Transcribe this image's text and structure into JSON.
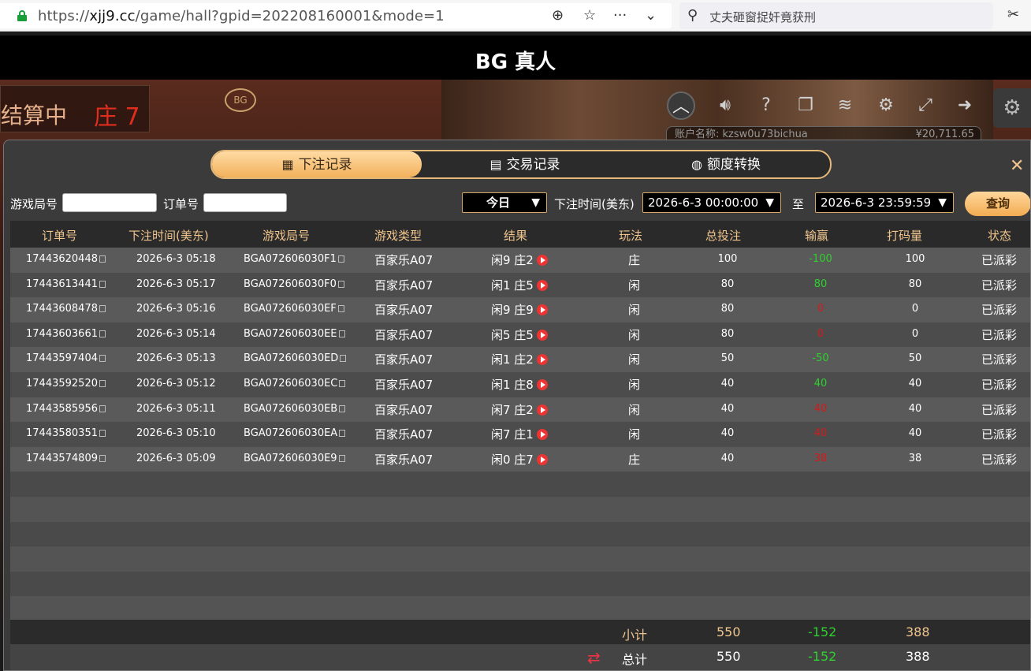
{
  "browser": {
    "url_prefix": "https://",
    "url_host": "xjj9.cc",
    "url_path": "/game/hall?gpid=202208160001&mode=1",
    "search_placeholder": "丈夫砸窗捉奸竟获刑"
  },
  "app": {
    "title": "BG 真人"
  },
  "game": {
    "settle_status": "结算中",
    "settle_result": "庄 7",
    "account_label": "账户名称: kzsw0u73bichua",
    "balance": "¥20,711.65"
  },
  "tabs": [
    {
      "label": "下注记录",
      "icon": "calendar-icon",
      "active": true
    },
    {
      "label": "交易记录",
      "icon": "clipboard-icon",
      "active": false
    },
    {
      "label": "额度转换",
      "icon": "coins-icon",
      "active": false
    }
  ],
  "filters": {
    "round_label": "游戏局号",
    "order_label": "订单号",
    "period_value": "今日",
    "time_label": "下注时间(美东)",
    "start_time": "2026-6-3 00:00:00",
    "to_label": "至",
    "end_time": "2026-6-3 23:59:59",
    "query_label": "查询"
  },
  "table": {
    "columns": [
      "订单号",
      "下注时间(美东)",
      "游戏局号",
      "游戏类型",
      "结果",
      "玩法",
      "总投注",
      "输赢",
      "打码量",
      "状态"
    ],
    "rows": [
      {
        "order": "17443620448",
        "time": "2026-6-3 05:18",
        "round": "BGA072606030F1",
        "type": "百家乐A07",
        "result": "闲9 庄2",
        "play": "庄",
        "bet": "100",
        "win": "-100",
        "win_color": "green",
        "code": "100",
        "status": "已派彩"
      },
      {
        "order": "17443613441",
        "time": "2026-6-3 05:17",
        "round": "BGA072606030F0",
        "type": "百家乐A07",
        "result": "闲1 庄5",
        "play": "闲",
        "bet": "80",
        "win": "80",
        "win_color": "green",
        "code": "80",
        "status": "已派彩"
      },
      {
        "order": "17443608478",
        "time": "2026-6-3 05:16",
        "round": "BGA072606030EF",
        "type": "百家乐A07",
        "result": "闲9 庄9",
        "play": "闲",
        "bet": "80",
        "win": "0",
        "win_color": "red",
        "code": "0",
        "status": "已派彩"
      },
      {
        "order": "17443603661",
        "time": "2026-6-3 05:14",
        "round": "BGA072606030EE",
        "type": "百家乐A07",
        "result": "闲5 庄5",
        "play": "闲",
        "bet": "80",
        "win": "0",
        "win_color": "red",
        "code": "0",
        "status": "已派彩"
      },
      {
        "order": "17443597404",
        "time": "2026-6-3 05:13",
        "round": "BGA072606030ED",
        "type": "百家乐A07",
        "result": "闲1 庄2",
        "play": "闲",
        "bet": "50",
        "win": "-50",
        "win_color": "green",
        "code": "50",
        "status": "已派彩"
      },
      {
        "order": "17443592520",
        "time": "2026-6-3 05:12",
        "round": "BGA072606030EC",
        "type": "百家乐A07",
        "result": "闲1 庄8",
        "play": "闲",
        "bet": "40",
        "win": "40",
        "win_color": "green",
        "code": "40",
        "status": "已派彩"
      },
      {
        "order": "17443585956",
        "time": "2026-6-3 05:11",
        "round": "BGA072606030EB",
        "type": "百家乐A07",
        "result": "闲7 庄2",
        "play": "闲",
        "bet": "40",
        "win": "40",
        "win_color": "red",
        "code": "40",
        "status": "已派彩"
      },
      {
        "order": "17443580351",
        "time": "2026-6-3 05:10",
        "round": "BGA072606030EA",
        "type": "百家乐A07",
        "result": "闲7 庄1",
        "play": "闲",
        "bet": "40",
        "win": "40",
        "win_color": "red",
        "code": "40",
        "status": "已派彩"
      },
      {
        "order": "17443574809",
        "time": "2026-6-3 05:09",
        "round": "BGA072606030E9",
        "type": "百家乐A07",
        "result": "闲0 庄7",
        "play": "庄",
        "bet": "40",
        "win": "38",
        "win_color": "red",
        "code": "38",
        "status": "已派彩"
      }
    ]
  },
  "summary": {
    "subtotal_label": "小计",
    "subtotal_bet": "550",
    "subtotal_win": "-152",
    "subtotal_code": "388",
    "total_label": "总计",
    "total_bet": "550",
    "total_win": "-152",
    "total_code": "388"
  },
  "colors": {
    "accent": "#f0c58e",
    "win_green": "#2ed12e",
    "loss_red": "#d61a1a"
  }
}
